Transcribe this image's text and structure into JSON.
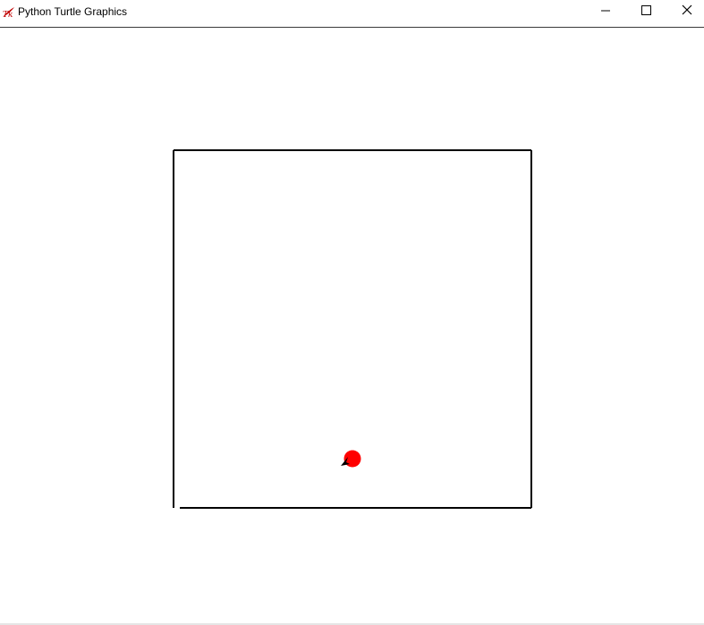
{
  "window": {
    "title": "Python Turtle Graphics",
    "icon": "tk-feather-icon",
    "controls": {
      "minimize": "minimize-icon",
      "maximize": "maximize-icon",
      "close": "close-icon"
    }
  },
  "canvas": {
    "background": "#ffffff",
    "border_color": "#000000",
    "ball_color": "#ff0000",
    "turtle_color": "#000000"
  }
}
